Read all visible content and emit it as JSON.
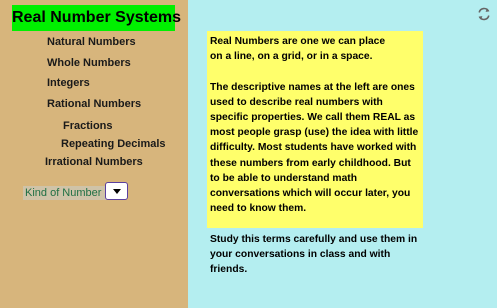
{
  "title": "Real Number Systems",
  "nav": {
    "natural": "Natural Numbers",
    "whole": "Whole Numbers",
    "integers": "Integers",
    "rational": "Rational Numbers",
    "fractions": "Fractions",
    "repeating": "Repeating Decimals",
    "irrational": "Irrational Numbers"
  },
  "kind_selector": {
    "label": "Kind of Number :",
    "selected": ""
  },
  "info": {
    "paragraphs": [
      "Real Numbers are one we can place\non a line, on a grid, or in a space.",
      "The descriptive names at the left are ones used to describe real numbers with specific properties. We call them REAL as most people grasp (use) the idea with little difficulty. Most students have worked with these numbers from early childhood. But to be able to understand math conversations which will occur later, you need to know them.",
      "Study this terms carefully and use them in your conversations in class and with friends."
    ]
  },
  "colors": {
    "left_panel": "#d7b57c",
    "right_panel": "#b4eef0",
    "title_bg": "#00f000",
    "info_bg": "#ffff6b"
  },
  "icons": {
    "refresh": "refresh-icon",
    "dropdown": "chevron-down-icon"
  }
}
